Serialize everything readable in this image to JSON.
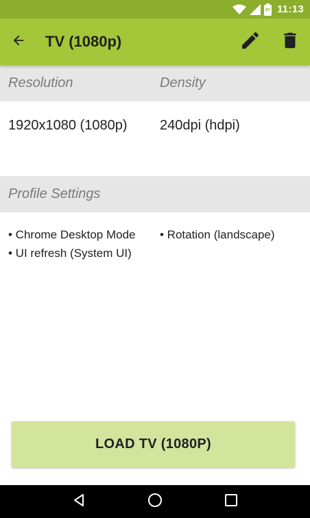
{
  "status_bar": {
    "time": "11:13",
    "battery_level": "97",
    "icons": [
      "wifi-icon",
      "signal-icon",
      "battery-icon"
    ],
    "color": "#8cae2c"
  },
  "app_bar": {
    "title": "TV (1080p)",
    "color": "#a4c639",
    "icons": [
      "back-arrow-icon",
      "edit-icon",
      "delete-icon"
    ]
  },
  "display": {
    "resolution_header": "Resolution",
    "density_header": "Density",
    "resolution_value": "1920x1080 (1080p)",
    "density_value": "240dpi (hdpi)"
  },
  "profile_settings": {
    "header": "Profile Settings",
    "left_items": [
      "• Chrome Desktop Mode",
      "• UI refresh (System UI)"
    ],
    "right_items": [
      "• Rotation (landscape)"
    ]
  },
  "load_button": {
    "label": "LOAD TV (1080P)",
    "color": "#d3e49d"
  },
  "nav_bar": {
    "icons": [
      "back-triangle-icon",
      "home-circle-icon",
      "recents-square-icon"
    ]
  }
}
